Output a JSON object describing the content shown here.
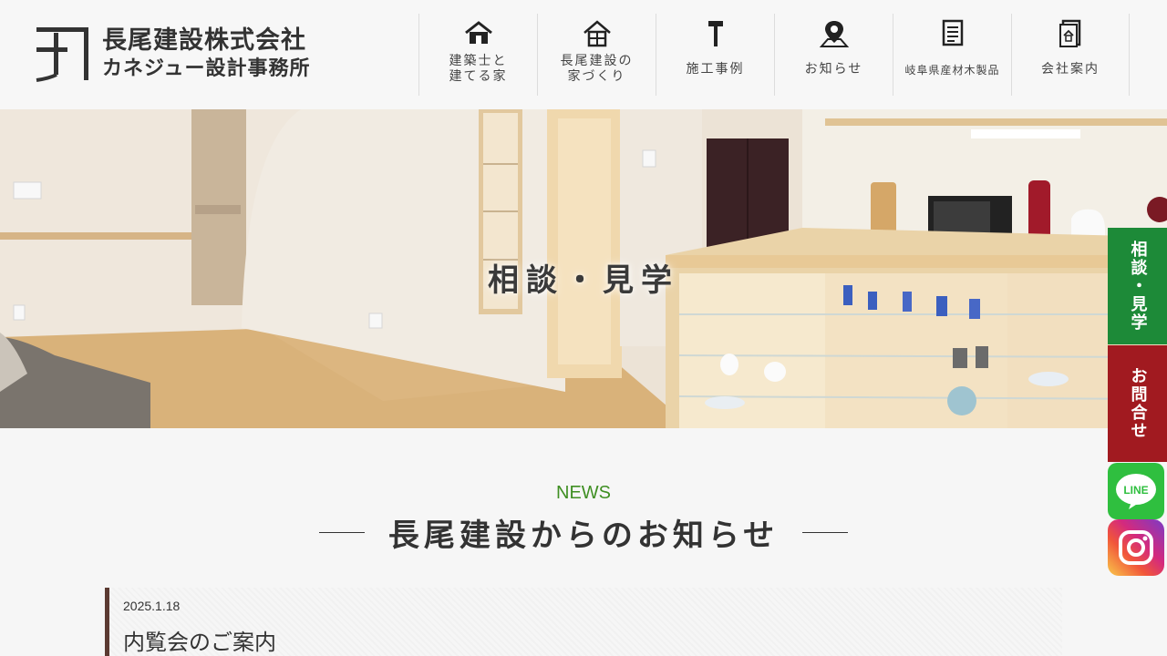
{
  "brand": {
    "company": "長尾建設株式会社",
    "office": "カネジュー設計事務所"
  },
  "nav": [
    {
      "label": "建築士と\n建てる家",
      "icon": "house-icon"
    },
    {
      "label": "長尾建設の\n家づくり",
      "icon": "house-building-icon"
    },
    {
      "label": "施工事例",
      "icon": "hammer-icon"
    },
    {
      "label": "お知らせ",
      "icon": "map-pin-icon"
    },
    {
      "label": "岐阜県産材木製品",
      "icon": "document-list-icon"
    },
    {
      "label": "会社案内",
      "icon": "company-document-icon"
    }
  ],
  "hero": {
    "title": "相談・見学"
  },
  "side": {
    "consult_label": "相談・見学",
    "contact_label": "お問合せ",
    "line_label": "LINE",
    "consult_color": "#1d8a38",
    "contact_color": "#a11a20"
  },
  "news": {
    "heading_en": "NEWS",
    "heading_ja": "長尾建設からのお知らせ",
    "items": [
      {
        "date": "2025.1.18",
        "title": "内覧会のご案内"
      }
    ]
  }
}
